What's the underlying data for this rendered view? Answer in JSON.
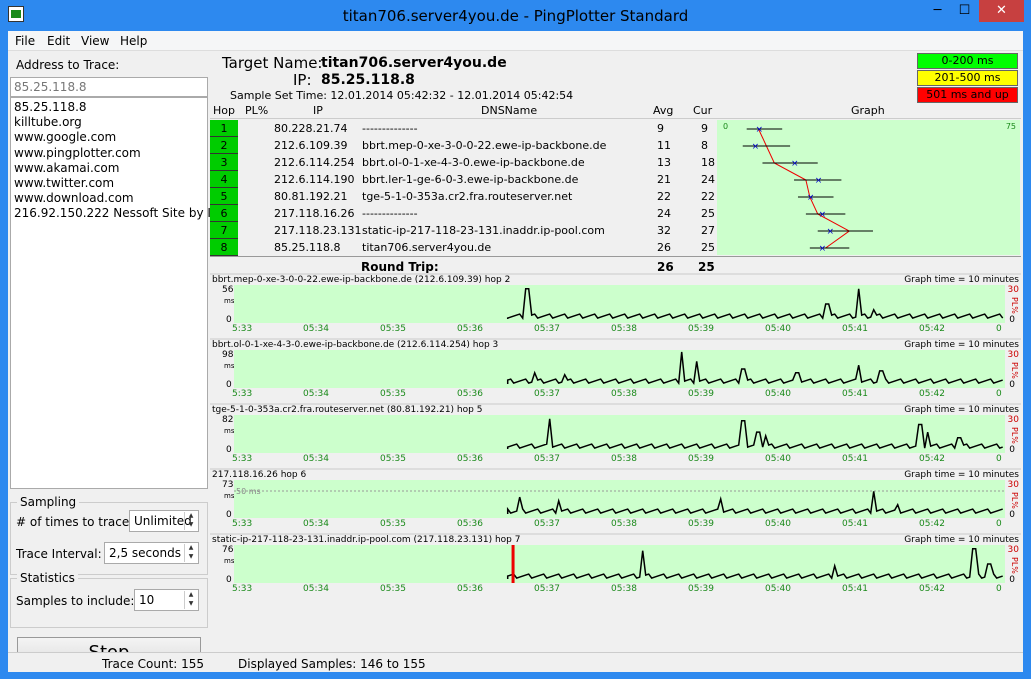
{
  "window": {
    "title": "titan706.server4you.de - PingPlotter Standard",
    "min": "─",
    "max": "☐",
    "close": "✕"
  },
  "menu": [
    "File",
    "Edit",
    "View",
    "Help"
  ],
  "left": {
    "address_label": "Address to Trace:",
    "address_value": "85.25.118.8",
    "addresses": [
      "85.25.118.8",
      "killtube.org",
      "www.google.com",
      "www.pingplotter.com",
      "www.akamai.com",
      "www.twitter.com",
      "www.download.com",
      "216.92.150.222 Nessoft Site by IP"
    ],
    "sampling": {
      "title": "Sampling",
      "times_label": "# of times to trace:",
      "times_value": "Unlimited",
      "interval_label": "Trace Interval:",
      "interval_value": "2,5 seconds"
    },
    "statistics": {
      "title": "Statistics",
      "samples_label": "Samples to include:",
      "samples_value": "10"
    },
    "stop": "Stop"
  },
  "status": {
    "trace_count": "Trace Count: 155",
    "displayed": "Displayed Samples: 146 to 155"
  },
  "header": {
    "target_label": "Target Name:",
    "target_value": "titan706.server4you.de",
    "ip_label": "IP:",
    "ip_value": "85.25.118.8",
    "sample_time": "Sample Set Time:  12.01.2014 05:42:32 - 12.01.2014 05:42:54"
  },
  "legend": [
    {
      "label": "0-200 ms",
      "color": "#00ff00",
      "text": "#000000"
    },
    {
      "label": "201-500 ms",
      "color": "#ffff00",
      "text": "#000000"
    },
    {
      "label": "501 ms and up",
      "color": "#ff0000",
      "text": "#000000"
    }
  ],
  "table": {
    "headers": {
      "hop": "Hop",
      "pl": "PL%",
      "ip": "IP",
      "dns": "DNSName",
      "avg": "Avg",
      "cur": "Cur",
      "graph": "Graph"
    },
    "graph_scale": {
      "min": "0",
      "max": "75"
    },
    "rows": [
      {
        "hop": "1",
        "ip": "80.228.21.74",
        "dns": " --------------",
        "avg": "9",
        "cur": "9"
      },
      {
        "hop": "2",
        "ip": "212.6.109.39",
        "dns": "bbrt.mep-0-xe-3-0-0-22.ewe-ip-backbone.de",
        "avg": "11",
        "cur": "8"
      },
      {
        "hop": "3",
        "ip": "212.6.114.254",
        "dns": "bbrt.ol-0-1-xe-4-3-0.ewe-ip-backbone.de",
        "avg": "13",
        "cur": "18"
      },
      {
        "hop": "4",
        "ip": "212.6.114.190",
        "dns": "bbrt.ler-1-ge-6-0-3.ewe-ip-backbone.de",
        "avg": "21",
        "cur": "24"
      },
      {
        "hop": "5",
        "ip": "80.81.192.21",
        "dns": "tge-5-1-0-353a.cr2.fra.routeserver.net",
        "avg": "22",
        "cur": "22"
      },
      {
        "hop": "6",
        "ip": "217.118.16.26",
        "dns": " --------------",
        "avg": "24",
        "cur": "25"
      },
      {
        "hop": "7",
        "ip": "217.118.23.131",
        "dns": "static-ip-217-118-23-131.inaddr.ip-pool.com",
        "avg": "32",
        "cur": "27"
      },
      {
        "hop": "8",
        "ip": "85.25.118.8",
        "dns": "titan706.server4you.de",
        "avg": "26",
        "cur": "25"
      }
    ],
    "round_trip": {
      "label": "Round Trip:",
      "avg": "26",
      "cur": "25"
    }
  },
  "mini_graphs": [
    {
      "title": "bbrt.mep-0-xe-3-0-0-22.ewe-ip-backbone.de (212.6.109.39) hop 2",
      "graph_time": "Graph time = 10 minutes",
      "max": "56",
      "spikes": [
        [
          0.38,
          0.9
        ],
        [
          0.77,
          0.5
        ],
        [
          0.81,
          0.9
        ],
        [
          0.83,
          0.35
        ]
      ]
    },
    {
      "title": "bbrt.ol-0-1-xe-4-3-0.ewe-ip-backbone.de (212.6.114.254) hop 3",
      "graph_time": "Graph time = 10 minutes",
      "max": "98",
      "spikes": [
        [
          0.39,
          0.4
        ],
        [
          0.43,
          0.35
        ],
        [
          0.58,
          0.95
        ],
        [
          0.6,
          0.7
        ],
        [
          0.66,
          0.5
        ],
        [
          0.73,
          0.4
        ],
        [
          0.81,
          0.6
        ],
        [
          0.84,
          0.45
        ]
      ]
    },
    {
      "title": "tge-5-1-0-353a.cr2.fra.routeserver.net (80.81.192.21) hop 5",
      "graph_time": "Graph time = 10 minutes",
      "max": "82",
      "spikes": [
        [
          0.41,
          0.9
        ],
        [
          0.66,
          0.85
        ],
        [
          0.68,
          0.55
        ],
        [
          0.69,
          0.45
        ],
        [
          0.89,
          0.75
        ],
        [
          0.9,
          0.55
        ],
        [
          0.94,
          0.4
        ]
      ]
    },
    {
      "title": "217.118.16.26 hop 6",
      "graph_time": "Graph time = 10 minutes",
      "max": "73",
      "sub": "50 ms",
      "spikes": [
        [
          0.37,
          0.55
        ],
        [
          0.42,
          0.45
        ],
        [
          0.63,
          0.5
        ],
        [
          0.83,
          0.7
        ],
        [
          0.86,
          0.35
        ]
      ]
    },
    {
      "title": "static-ip-217-118-23-131.inaddr.ip-pool.com (217.118.23.131) hop 7",
      "graph_time": "Graph time = 10 minutes",
      "max": "76",
      "spikes": [
        [
          0.53,
          0.85
        ],
        [
          0.78,
          0.45
        ],
        [
          0.96,
          0.9
        ],
        [
          0.98,
          0.5
        ]
      ],
      "loss": 0.36
    }
  ],
  "x_ticks": [
    "5:33",
    "05:34",
    "05:35",
    "05:36",
    "05:37",
    "05:38",
    "05:39",
    "05:40",
    "05:41",
    "05:42",
    "0"
  ],
  "y_unit": "ms",
  "pl_unit": "PL%",
  "pl_max": "30",
  "zero": "0"
}
